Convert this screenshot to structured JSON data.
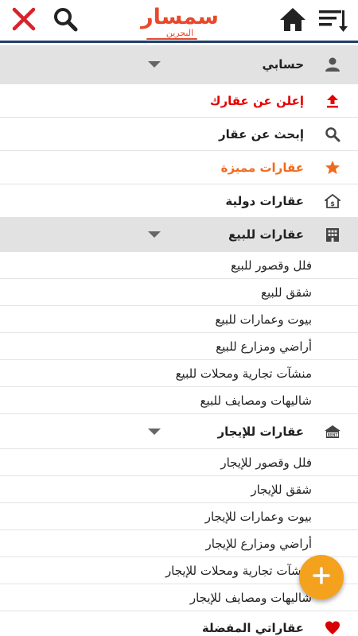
{
  "header": {
    "logo_main": "سمسار",
    "logo_sub": "البحرين",
    "close_icon": "close-icon",
    "search_icon": "search-icon",
    "home_icon": "home-icon",
    "menu_icon": "sort-menu-icon"
  },
  "menu": {
    "account": {
      "label": "حسابي",
      "icon": "person-icon"
    },
    "post_ad": {
      "label": "إعلن عن عقارك",
      "icon": "upload-icon",
      "color": "#e60000"
    },
    "search": {
      "label": "إبحث عن عقار",
      "icon": "search-icon"
    },
    "featured": {
      "label": "عقارات مميزة",
      "icon": "star-icon",
      "color": "#f06a1d"
    },
    "international": {
      "label": "عقارات دولية",
      "icon": "house-dollar-icon"
    },
    "for_sale": {
      "label": "عقارات للبيع",
      "icon": "building-icon",
      "items": [
        "فلل وقصور للبيع",
        "شقق للبيع",
        "بيوت وعمارات للبيع",
        "أراضي ومزارع للبيع",
        "منشآت تجارية ومحلات للبيع",
        "شاليهات ومصايف للبيع"
      ]
    },
    "for_rent": {
      "label": "عقارات للإيجار",
      "icon": "rent-icon",
      "items": [
        "فلل وقصور للإيجار",
        "شقق للإيجار",
        "بيوت وعمارات للإيجار",
        "أراضي ومزارع للإيجار",
        "منشآت تجارية ومحلات للإيجار",
        "شاليهات ومصايف للإيجار"
      ]
    },
    "favorites": {
      "label": "عقاراتي المفضلة",
      "icon": "heart-icon",
      "color": "#d80000"
    }
  },
  "fab": {
    "label": "+",
    "icon": "plus-icon",
    "color": "#f4a21e"
  }
}
